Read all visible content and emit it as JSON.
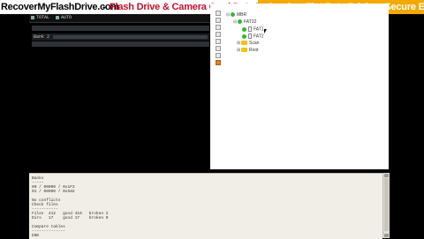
{
  "banner": {
    "site": "RecoverMyFlashDrive.com",
    "sep": "-",
    "tagline": "Flash Drive & Camera Card Data Recovery",
    "promo": "y Service, Flat Rate Pricing, Secure Encryp"
  },
  "toolbar": {
    "btn1": "TOTAL",
    "btn2": "AUTO"
  },
  "left": {
    "bank_label": "Bank 2"
  },
  "tree": {
    "root": "MBR",
    "fat": "FAT32",
    "file1": "FAT1",
    "file2": "FAT2",
    "folder1": "Scan",
    "folder2": "Root"
  },
  "log": [
    "Banks",
    "-----",
    "00 / 00000 / 0x1F3",
    "01 / 00000 / 0x582",
    "",
    "No conflicts",
    "Check files",
    "-----------",
    "Files  412   good 410   broken 2",
    "Dirs   17    good 17    broken 0",
    "",
    "Compare tables",
    "--------------",
    "END"
  ]
}
